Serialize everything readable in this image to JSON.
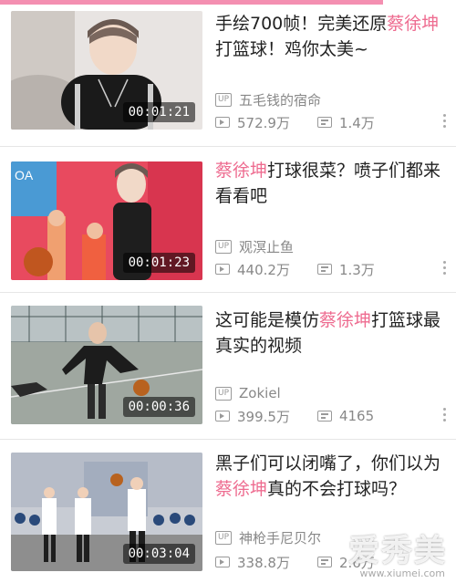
{
  "videos": [
    {
      "title_parts": [
        "手绘700帧！完美还原",
        "蔡徐坤",
        "打篮球！鸡你太美~"
      ],
      "author": "五毛钱的宿命",
      "views": "572.9万",
      "danmaku": "1.4万",
      "duration": "00:01:21"
    },
    {
      "title_parts": [
        "",
        "蔡徐坤",
        "打球很菜？喷子们都来看看吧"
      ],
      "author": "观溟止鱼",
      "views": "440.2万",
      "danmaku": "1.3万",
      "duration": "00:01:23"
    },
    {
      "title_parts": [
        "这可能是模仿",
        "蔡徐坤",
        "打篮球最真实的视频"
      ],
      "author": "Zokiel",
      "views": "399.5万",
      "danmaku": "4165",
      "duration": "00:00:36"
    },
    {
      "title_parts": [
        "黑子们可以闭嘴了，你们以为",
        "蔡徐坤",
        "真的不会打球吗？"
      ],
      "author": "神枪手尼贝尔",
      "views": "338.8万",
      "danmaku": "2.6万",
      "duration": "00:03:04"
    }
  ],
  "up_label": "UP",
  "watermark": "爱秀美",
  "watermark_url": "www.xiumei.com",
  "colors": {
    "accent": "#ee6c90",
    "topbar": "#f48fb1"
  },
  "icons": {
    "views": "play-icon",
    "danmaku": "danmaku-icon",
    "more": "more-icon"
  }
}
